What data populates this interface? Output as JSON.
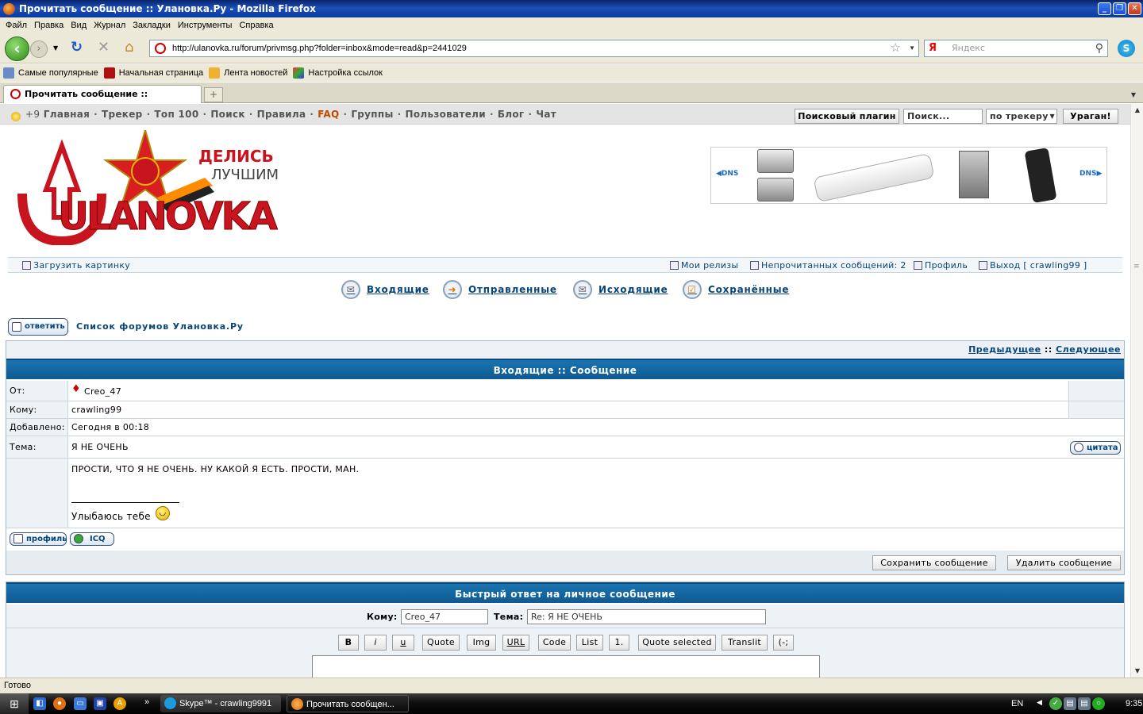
{
  "window": {
    "title": "Прочитать сообщение :: Улановка.Ру - Mozilla Firefox"
  },
  "menu": [
    "Файл",
    "Правка",
    "Вид",
    "Журнал",
    "Закладки",
    "Инструменты",
    "Справка"
  ],
  "nav": {
    "url": "http://ulanovka.ru/forum/privmsg.php?folder=inbox&mode=read&p=2441029",
    "search_placeholder": "Яндекс",
    "search_engine_letter": "Я"
  },
  "bookmarks": [
    "Самые популярные",
    "Начальная страница",
    "Лента новостей",
    "Настройка ссылок"
  ],
  "tab": {
    "title": "Прочитать сообщение :: Улановка.Ру"
  },
  "site_nav": {
    "bonus": "+9",
    "items": [
      "Главная",
      "Трекер",
      "Топ 100",
      "Поиск",
      "Правила",
      "FAQ",
      "Группы",
      "Пользователи",
      "Блог",
      "Чат"
    ],
    "search_plugin": "Поисковый плагин",
    "search_placeholder": "Поиск...",
    "search_scope": "по трекеру",
    "search_button": "Ураган!"
  },
  "logo": {
    "slogan_top": "ДЕЛИСЬ",
    "slogan_bottom": "ЛУЧШИМ",
    "brand": "ULANOVKA"
  },
  "banner": {
    "brand": "DNS"
  },
  "userbar": {
    "upload": "Загрузить картинку",
    "releases": "Мои релизы",
    "unread": "Непрочитанных сообщений: 2",
    "profile": "Профиль",
    "logout": "Выход [ crawling99 ]"
  },
  "pm_tabs": [
    "Входящие",
    "Отправленные",
    "Исходящие",
    "Сохранённые"
  ],
  "reply_button": "ответить",
  "forum_link": "Список форумов Улановка.Ру",
  "message": {
    "prev": "Предыдущее",
    "sep": "::",
    "next": "Следующее",
    "header": "Входящие :: Сообщение",
    "labels": {
      "from": "От:",
      "to": "Кому:",
      "added": "Добавлено:",
      "subject": "Тема:"
    },
    "from": "Creo_47",
    "to": "crawling99",
    "added": "Сегодня в 00:18",
    "subject": "Я НЕ ОЧЕНЬ",
    "quote_button": "цитата",
    "body": "ПРОСТИ, ЧТО Я НЕ ОЧЕНЬ. НУ КАКОЙ Я ЕСТЬ. ПРОСТИ, МАН.",
    "signature": "Улыбаюсь тебе",
    "profile_button": "профиль",
    "icq_button": "ICQ",
    "save_button": "Сохранить сообщение",
    "delete_button": "Удалить сообщение"
  },
  "quick_reply": {
    "header": "Быстрый ответ на личное сообщение",
    "to_label": "Кому:",
    "to_value": "Creo_47",
    "subject_label": "Тема:",
    "subject_value": "Re: Я НЕ ОЧЕНЬ",
    "editor_buttons": [
      "B",
      "i",
      "u",
      "Quote",
      "Img",
      "URL",
      "Code",
      "List",
      "1.",
      "Quote selected",
      "Translit",
      "(-;"
    ]
  },
  "status": "Готово",
  "taskbar": {
    "apps": [
      "Skype™ - crawling9991",
      "Прочитать сообщен..."
    ],
    "lang": "EN",
    "time": "9:35"
  }
}
